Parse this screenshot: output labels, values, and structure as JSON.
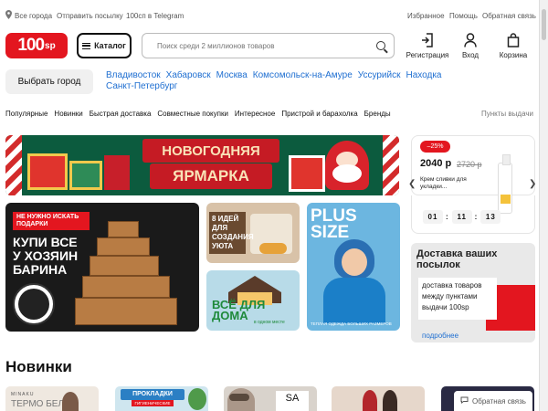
{
  "topbar": {
    "city": "Все города",
    "send": "Отправить посылку",
    "telegram": "100сп в Telegram",
    "favorites": "Избранное",
    "help": "Помощь",
    "feedback": "Обратная связь",
    "location_icon": "location-pin-icon"
  },
  "header": {
    "logo": "100",
    "logo_suffix": "sp",
    "catalog": "Каталог",
    "search_placeholder": "Поиск среди 2 миллионов товаров",
    "register": "Регистрация",
    "login": "Вход",
    "cart": "Корзина"
  },
  "cities": {
    "choose": "Выбрать город",
    "list": [
      "Владивосток",
      "Хабаровск",
      "Москва",
      "Комсомольск-на-Амуре",
      "Уссурийск",
      "Находка",
      "Санкт-Петербург"
    ]
  },
  "nav": {
    "items": [
      "Популярные",
      "Новинки",
      "Быстрая доставка",
      "Совместные покупки",
      "Интересное",
      "Пристрой и барахолка",
      "Бренды"
    ],
    "pickup": "Пункты выдачи"
  },
  "banner": {
    "line1": "НОВОГОДНЯЯ",
    "line2": "ЯРМАРКА"
  },
  "promo": {
    "discount": "–25%",
    "price": "2040 р",
    "old_price": "2720 р",
    "product": "Крем сливки для укладки...",
    "timer": [
      "01",
      "11",
      "13"
    ]
  },
  "tiles": {
    "bags_tag": "НЕ НУЖНО ИСКАТЬ ПОДАРКИ",
    "bags_title": "КУПИ ВСЕ У ХОЗЯИН БАРИНА",
    "cozy": "8 ИДЕЙ ДЛЯ СОЗДАНИЯ УЮТА",
    "home": "ВСЁ ДЛЯ ДОМА",
    "home_sub": "в одном месте",
    "plus": "PLUS SIZE",
    "plus_foot": "ТЕПЛАЯ ОДЕЖДА БОЛЬШИХ РАЗМЕРОВ",
    "delivery_title": "Доставка ваших посылок",
    "delivery_text": "доставка товаров между пунктами выдачи 100sp",
    "delivery_link": "подробнее"
  },
  "new_section": {
    "title": "Новинки",
    "c1_brand": "MINAKU",
    "c1_text": "ТЕРМО БЕЛЬЕ",
    "c2_text": "ПРОКЛАДКИ",
    "c2_sub": "ГИГИЕНИЧЕСКИЕ",
    "c3_text": "SA"
  },
  "colors": {
    "brand": "#e3161f",
    "link": "#1f6fd1"
  }
}
